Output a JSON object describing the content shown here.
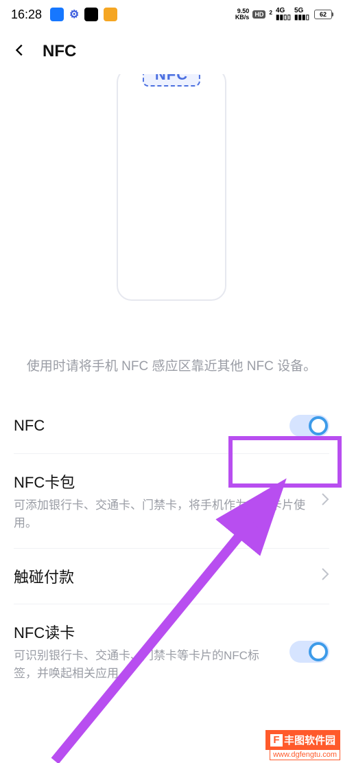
{
  "status": {
    "time": "16:28",
    "kbps_top": "9.50",
    "kbps_bottom": "KB/s",
    "hd": "HD",
    "sim": "2",
    "net1": "4G",
    "net2": "5G",
    "battery": "62"
  },
  "header": {
    "title": "NFC"
  },
  "illustration": {
    "nfc_badge": "NFC"
  },
  "hint": "使用时请将手机 NFC 感应区靠近其他 NFC 设备。",
  "settings": {
    "nfc": {
      "label": "NFC"
    },
    "card_wallet": {
      "label": "NFC卡包",
      "desc": "可添加银行卡、交通卡、门禁卡，将手机作为虚拟卡片使用。"
    },
    "touch_pay": {
      "label": "触碰付款"
    },
    "reader": {
      "label": "NFC读卡",
      "desc": "可识别银行卡、交通卡、门禁卡等卡片的NFC标签，并唤起相关应用。"
    }
  },
  "watermark": {
    "brand": "丰图软件园",
    "url": "www.dgfengtu.com"
  }
}
